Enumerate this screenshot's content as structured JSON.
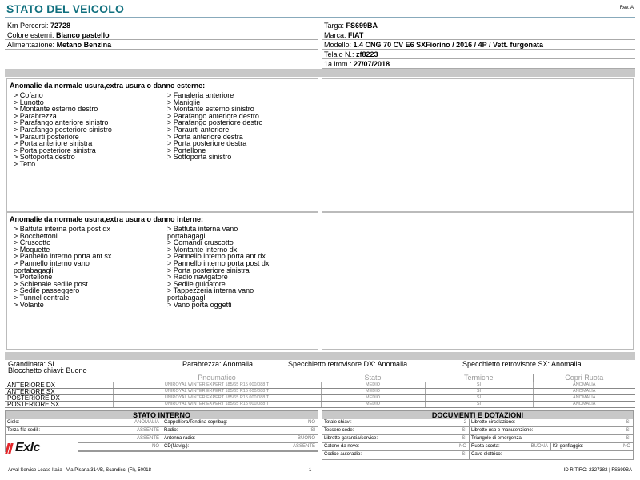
{
  "header": {
    "title": "STATO DEL VEICOLO",
    "rev": "Rev. A"
  },
  "info_left": [
    {
      "label": "Km Percorsi:",
      "value": "72728"
    },
    {
      "label": "Colore esterni:",
      "value": "Bianco pastello"
    },
    {
      "label": "Alimentazione:",
      "value": "Metano Benzina"
    }
  ],
  "info_right": [
    {
      "label": "Targa:",
      "value": "FS699BA"
    },
    {
      "label": "Marca:",
      "value": "FIAT"
    },
    {
      "label": "Modello:",
      "value": "1.4 CNG 70 CV E6 SXFiorino / 2016 / 4P / Vett. furgonata"
    },
    {
      "label": "Telaio N.:",
      "value": "zf8223"
    },
    {
      "label": "1a imm.:",
      "value": "27/07/2018"
    }
  ],
  "external": {
    "title": "Anomalie da normale usura,extra usura o danno esterne:",
    "col1": "> Cofano\n> Lunotto\n> Montante esterno destro\n> Parabrezza\n> Parafango anteriore sinistro\n> Parafango posteriore sinistro\n> Paraurti posteriore\n> Porta anteriore sinistra\n> Porta posteriore sinistra\n> Sottoporta destro\n> Tetto",
    "col2": "> Fanaleria anteriore\n> Maniglie\n> Montante esterno sinistro\n> Parafango anteriore destro\n> Parafango posteriore destro\n> Paraurti anteriore\n> Porta anteriore destra\n> Porta posteriore destra\n> Portellone\n> Sottoporta sinistro"
  },
  "internal": {
    "title": "Anomalie da normale usura,extra usura o danno interne:",
    "col1": "> Battuta interna porta post dx\n> Bocchettoni\n> Cruscotto\n> Moquette\n> Pannello interno porta ant sx\n> Pannello interno vano\nportabagagli\n> Portellone\n> Schienale sedile post\n> Sedile passeggero\n> Tunnel centrale\n> Volante",
    "col2": "> Battuta interna vano\nportabagagli\n> Comandi cruscotto\n> Montante interno dx\n> Pannello interno porta ant dx\n> Pannello interno porta post dx\n> Porta posteriore sinistra\n> Radio navigatore\n> Sedile guidatore\n> Tappezzeria interna vano\nportabagagli\n> Vano porta oggetti"
  },
  "summary": {
    "grandinata": "Grandinata: Si",
    "blocchetto": "Blocchetto chiavi: Buono",
    "parabrezza": "Parabrezza: Anomalia",
    "specchio_dx": "Specchietto retrovisore DX: Anomalia",
    "specchio_sx": "Specchietto retrovisore SX: Anomalia"
  },
  "tyres": {
    "headers": {
      "pneumatico": "Pneumatico",
      "stato": "Stato",
      "termiche": "Termiche",
      "copri": "Copri Ruota"
    },
    "rows": [
      {
        "pos": "ANTERIORE DX",
        "tyre": "UNIROYAL WINTER EXPERT 185/65 R15 000/088 T",
        "stato": "MEDIO",
        "termiche": "SI",
        "copri": "ANOMALIA"
      },
      {
        "pos": "ANTERIORE SX",
        "tyre": "UNIROYAL WINTER EXPERT 185/65 R15 000/088 T",
        "stato": "MEDIO",
        "termiche": "SI",
        "copri": "ANOMALIA"
      },
      {
        "pos": "POSTERIORE DX",
        "tyre": "UNIROYAL WINTER EXPERT 185/65 R15 000/088 T",
        "stato": "MEDIO",
        "termiche": "SI",
        "copri": "ANOMALIA"
      },
      {
        "pos": "POSTERIORE SX",
        "tyre": "UNIROYAL WINTER EXPERT 185/65 R15 000/088 T",
        "stato": "MEDIO",
        "termiche": "SI",
        "copri": "ANOMALIA"
      }
    ]
  },
  "stato_interno": {
    "title": "STATO INTERNO",
    "rows": [
      [
        {
          "k": "Cielo:",
          "v": "ANOMALIA"
        },
        {
          "k": "Cappelliera/Tendina copribag:",
          "v": "NO"
        }
      ],
      [
        {
          "k": "Terza fila sedili:",
          "v": "ASSENTE"
        },
        {
          "k": "Radio:",
          "v": "SI"
        }
      ],
      [
        {
          "k": "",
          "v": "ASSENTE"
        },
        {
          "k": "Antenna radio:",
          "v": "BUONO"
        }
      ],
      [
        {
          "k": "",
          "v": "NO"
        },
        {
          "k": "CD(Navig.):",
          "v": "ASSENTE"
        }
      ]
    ]
  },
  "documenti": {
    "title": "DOCUMENTI E DOTAZIONI",
    "rows": [
      [
        {
          "k": "Totale chiavi:",
          "v": "2"
        },
        {
          "k": "Libretto circolazione:",
          "v": "SI"
        }
      ],
      [
        {
          "k": "Tessere code:",
          "v": "SI"
        },
        {
          "k": "Libretto uso e manutenzione:",
          "v": "SI"
        }
      ],
      [
        {
          "k": "Libretto garanzia/service:",
          "v": "SI"
        },
        {
          "k": "Triangolo di emergenza:",
          "v": "SI"
        }
      ],
      [
        {
          "k": "Catene da neve:",
          "v": "NO"
        },
        {
          "k": "Ruota scorta:",
          "v": "BUONA"
        },
        {
          "k": "Kit gonfiaggio:",
          "v": "NO"
        }
      ],
      [
        {
          "k": "Codice autoradio:",
          "v": "SI"
        },
        {
          "k": "Cavo elettrico:",
          "v": ""
        }
      ]
    ]
  },
  "logo": {
    "text": "Exlc"
  },
  "footer": {
    "address": "Arval Service Lease Italia - Via Pisana 314/B, Scandicci (FI), 50018",
    "page": "1",
    "id": "ID RITIRO: 2327382 | FS699BA"
  }
}
